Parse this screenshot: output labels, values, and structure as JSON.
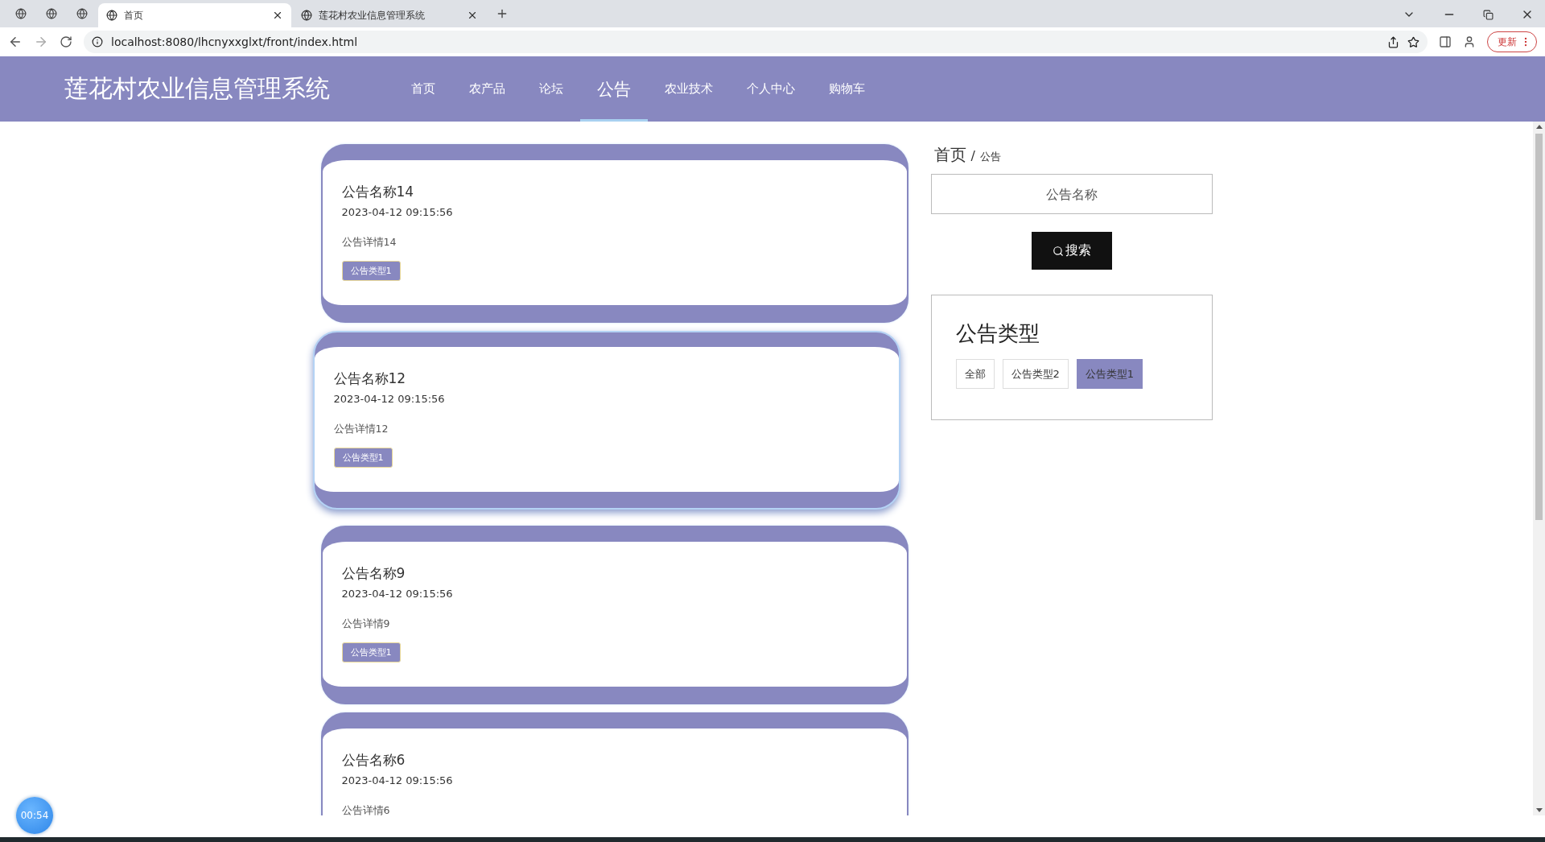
{
  "browser": {
    "tabs": [
      {
        "kind": "icon",
        "selected": false
      },
      {
        "kind": "icon",
        "selected": false
      },
      {
        "kind": "icon",
        "selected": false
      },
      {
        "kind": "page",
        "label": "首页",
        "selected": true
      },
      {
        "kind": "page",
        "label": "莲花村农业信息管理系统",
        "selected": false
      }
    ],
    "address": "localhost:8080/lhcnyxxglxt/front/index.html",
    "update_label": "更新"
  },
  "header": {
    "logo": "莲花村农业信息管理系统",
    "nav": [
      {
        "label": "首页",
        "selected": false
      },
      {
        "label": "农产品",
        "selected": false
      },
      {
        "label": "论坛",
        "selected": false
      },
      {
        "label": "公告",
        "selected": true
      },
      {
        "label": "农业技术",
        "selected": false
      },
      {
        "label": "个人中心",
        "selected": false
      },
      {
        "label": "购物车",
        "selected": false
      }
    ]
  },
  "notices": [
    {
      "title": "公告名称14",
      "time": "2023-04-12 09:15:56",
      "detail": "公告详情14",
      "tag": "公告类型1",
      "hovered": false
    },
    {
      "title": "公告名称12",
      "time": "2023-04-12 09:15:56",
      "detail": "公告详情12",
      "tag": "公告类型1",
      "hovered": true
    },
    {
      "title": "公告名称9",
      "time": "2023-04-12 09:15:56",
      "detail": "公告详情9",
      "tag": "公告类型1",
      "hovered": false
    },
    {
      "title": "公告名称6",
      "time": "2023-04-12 09:15:56",
      "detail": "公告详情6",
      "hovered": false
    }
  ],
  "sidebar": {
    "breadcrumb": {
      "home": "首页",
      "separator": "/",
      "current": "公告"
    },
    "search": {
      "placeholder": "公告名称"
    },
    "search_button": "搜索",
    "types": {
      "title": "公告类型",
      "items": [
        {
          "label": "全部",
          "selected": false
        },
        {
          "label": "公告类型2",
          "selected": false
        },
        {
          "label": "公告类型1",
          "selected": true
        }
      ]
    }
  },
  "timer": "00:54"
}
